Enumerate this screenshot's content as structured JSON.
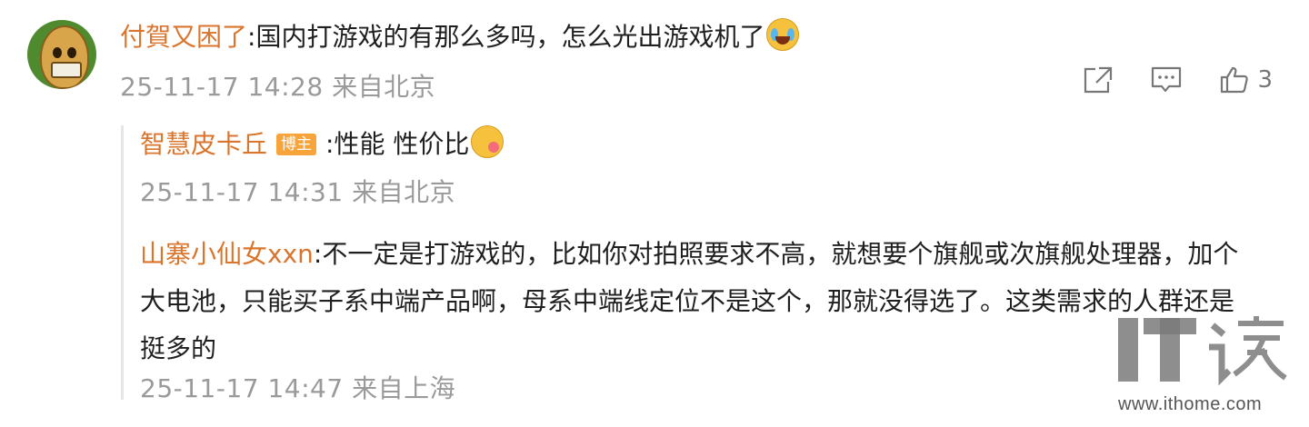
{
  "main_comment": {
    "username": "付賀又困了",
    "separator": ":",
    "text": "国内打游戏的有那么多吗，怎么光出游戏机了",
    "emoji": "laugh-cry-emoji",
    "timestamp": "25-11-17 14:28",
    "location": "来自北京",
    "like_count": "3"
  },
  "replies": [
    {
      "username": "智慧皮卡丘",
      "badge": "博主",
      "separator": ":",
      "text": "性能 性价比",
      "emoji": "heart-kiss-emoji",
      "timestamp": "25-11-17 14:31",
      "location": "来自北京"
    },
    {
      "username": "山寨小仙女xxn",
      "separator": ":",
      "text": "不一定是打游戏的，比如你对拍照要求不高，就想要个旗舰或次旗舰处理器，加个大电池，只能买子系中端产品啊，母系中端线定位不是这个，那就没得选了。这类需求的人群还是挺多的",
      "timestamp": "25-11-17 14:47",
      "location": "来自上海"
    }
  ],
  "watermark": {
    "logo": "IT之家",
    "url": "www.ithome.com"
  },
  "colors": {
    "username": "#d9752d",
    "meta": "#9a9a9a",
    "badge": "#f7a53a",
    "thread_bar": "#e6e6e6"
  }
}
